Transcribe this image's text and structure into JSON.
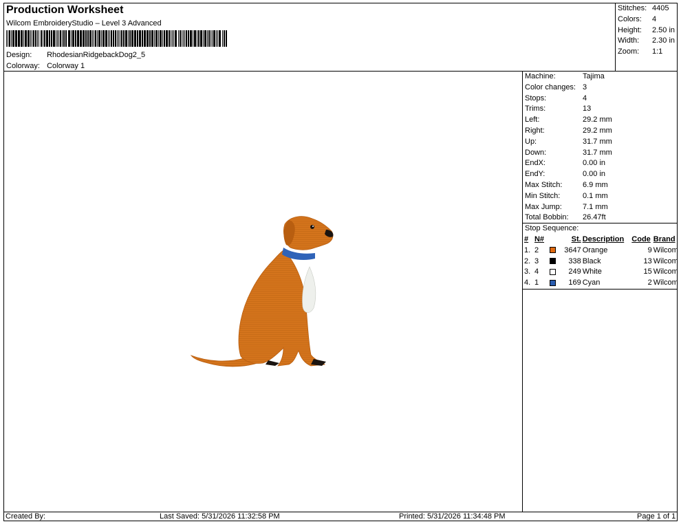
{
  "header": {
    "title": "Production Worksheet",
    "software": "Wilcom EmbroideryStudio – Level 3 Advanced",
    "design_label": "Design:",
    "design_value": "RhodesianRidgebackDog2_5",
    "colorway_label": "Colorway:",
    "colorway_value": "Colorway 1"
  },
  "stats": [
    {
      "label": "Stitches:",
      "value": "4405"
    },
    {
      "label": "Colors:",
      "value": "4"
    },
    {
      "label": "Height:",
      "value": "2.50 in"
    },
    {
      "label": "Width:",
      "value": "2.30 in"
    },
    {
      "label": "Zoom:",
      "value": "1:1"
    }
  ],
  "info": [
    {
      "label": "Machine:",
      "value": "Tajima"
    },
    {
      "label": "Color changes:",
      "value": "3"
    },
    {
      "label": "Stops:",
      "value": "4"
    },
    {
      "label": "Trims:",
      "value": "13"
    },
    {
      "label": "Left:",
      "value": "29.2 mm"
    },
    {
      "label": "Right:",
      "value": "29.2 mm"
    },
    {
      "label": "Up:",
      "value": "31.7 mm"
    },
    {
      "label": "Down:",
      "value": "31.7 mm"
    },
    {
      "label": "EndX:",
      "value": "0.00 in"
    },
    {
      "label": "EndY:",
      "value": "0.00 in"
    },
    {
      "label": "Max Stitch:",
      "value": "6.9 mm"
    },
    {
      "label": "Min Stitch:",
      "value": "0.1 mm"
    },
    {
      "label": "Max Jump:",
      "value": "7.1 mm"
    },
    {
      "label": "Total Bobbin:",
      "value": "26.47ft"
    }
  ],
  "stop_sequence": {
    "title": "Stop Sequence:",
    "columns": {
      "idx": "#",
      "n": "N#",
      "st": "St.",
      "desc": "Description",
      "code": "Code",
      "brand": "Brand"
    },
    "rows": [
      {
        "idx": "1.",
        "n": "2",
        "color": "#e06a10",
        "st": "3647",
        "desc": "Orange",
        "code": "9",
        "brand": "Wilcom"
      },
      {
        "idx": "2.",
        "n": "3",
        "color": "#000000",
        "st": "338",
        "desc": "Black",
        "code": "13",
        "brand": "Wilcom"
      },
      {
        "idx": "3.",
        "n": "4",
        "color": "#ffffff",
        "st": "249",
        "desc": "White",
        "code": "15",
        "brand": "Wilcom"
      },
      {
        "idx": "4.",
        "n": "1",
        "color": "#2a5db0",
        "st": "169",
        "desc": "Cyan",
        "code": "2",
        "brand": "Wilcom"
      }
    ]
  },
  "footer": {
    "created_by": "Created By:",
    "last_saved": "Last Saved: 5/31/2026 11:32:58 PM",
    "printed": "Printed: 5/31/2026 11:34:48 PM",
    "page": "Page 1 of 1"
  },
  "design_colors": {
    "body": "#d4741c",
    "body_shade": "#b85e10",
    "collar": "#2f63b8",
    "chest": "#eef0ec",
    "eye_nose": "#1a1410"
  }
}
